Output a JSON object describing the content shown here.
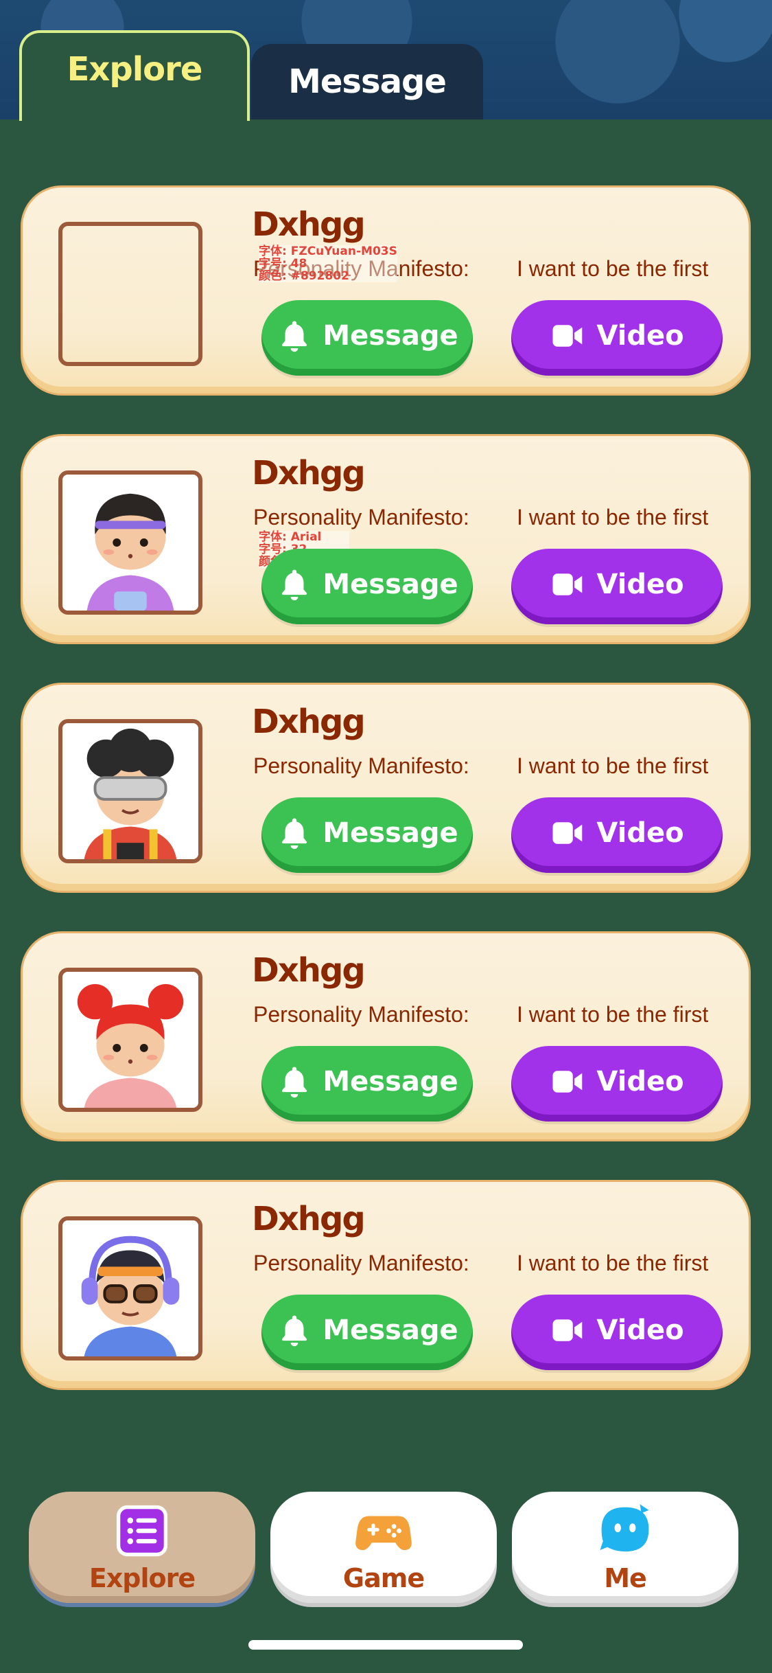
{
  "top_tabs": [
    {
      "label": "Explore",
      "active": true
    },
    {
      "label": "Message",
      "active": false
    }
  ],
  "cards": [
    {
      "name": "Dxhgg",
      "manifesto_label": "Personality Manifesto:",
      "manifesto_value": "I want to be the first",
      "message_label": "Message",
      "video_label": "Video",
      "avatar": "empty-avatar"
    },
    {
      "name": "Dxhgg",
      "manifesto_label": "Personality Manifesto:",
      "manifesto_value": "I want to be the first",
      "message_label": "Message",
      "video_label": "Video",
      "avatar": "boy-purple-headband-avatar"
    },
    {
      "name": "Dxhgg",
      "manifesto_label": "Personality Manifesto:",
      "manifesto_value": "I want to be the first",
      "message_label": "Message",
      "video_label": "Video",
      "avatar": "vr-headset-kid-avatar"
    },
    {
      "name": "Dxhgg",
      "manifesto_label": "Personality Manifesto:",
      "manifesto_value": "I want to be the first",
      "message_label": "Message",
      "video_label": "Video",
      "avatar": "girl-red-buns-avatar"
    },
    {
      "name": "Dxhgg",
      "manifesto_label": "Personality Manifesto:",
      "manifesto_value": "I want to be the first",
      "message_label": "Message",
      "video_label": "Video",
      "avatar": "headphones-glasses-avatar"
    }
  ],
  "annotations": [
    {
      "line1": "字体: FZCuYuan-M03S",
      "line2": "字号: 48",
      "line3": "颜色: #892802"
    },
    {
      "line1": "字体: Arial",
      "line2": "字号: 32",
      "line3": "颜色: #892802"
    }
  ],
  "bottom_nav": [
    {
      "label": "Explore",
      "icon": "list-icon",
      "active": true
    },
    {
      "label": "Game",
      "icon": "gamepad-icon",
      "active": false
    },
    {
      "label": "Me",
      "icon": "chat-bubble-face-icon",
      "active": false
    }
  ],
  "colors": {
    "background": "#2b5741",
    "text_brown": "#892802",
    "message_green": "#3cc153",
    "video_purple": "#a231ea",
    "explore_tab_text": "#f6ef82"
  }
}
